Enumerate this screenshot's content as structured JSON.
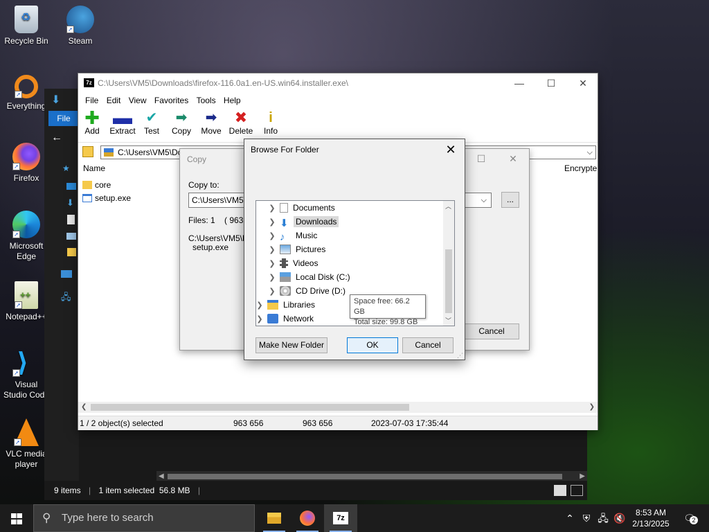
{
  "desktop": {
    "icons": [
      {
        "label": "Recycle Bin"
      },
      {
        "label": "Steam"
      },
      {
        "label": "Everything"
      },
      {
        "label": "Firefox"
      },
      {
        "label": "Microsoft Edge"
      },
      {
        "label": "Notepad++"
      },
      {
        "label": "Visual Studio Code"
      },
      {
        "label": "VLC media player"
      }
    ]
  },
  "explorer": {
    "file_tab": "File",
    "status_items": "9 items",
    "status_selected": "1 item selected  56.8 MB"
  },
  "sevenzip": {
    "title": "C:\\Users\\VM5\\Downloads\\firefox-116.0a1.en-US.win64.installer.exe\\",
    "menu": [
      "File",
      "Edit",
      "View",
      "Favorites",
      "Tools",
      "Help"
    ],
    "toolbar": [
      {
        "label": "Add",
        "icon": "add-icon"
      },
      {
        "label": "Extract",
        "icon": "extract-icon"
      },
      {
        "label": "Test",
        "icon": "test-icon"
      },
      {
        "label": "Copy",
        "icon": "copy-icon"
      },
      {
        "label": "Move",
        "icon": "move-icon"
      },
      {
        "label": "Delete",
        "icon": "delete-icon"
      },
      {
        "label": "Info",
        "icon": "info-icon"
      }
    ],
    "address": "C:\\Users\\VM5\\Do",
    "columns": {
      "name": "Name",
      "encrypted": "Encrypte"
    },
    "files": [
      {
        "name": "core",
        "type": "folder"
      },
      {
        "name": "setup.exe",
        "type": "file"
      }
    ],
    "status": {
      "selected": "1 / 2 object(s) selected",
      "size": "963 656",
      "packed": "963 656",
      "modified": "2023-07-03 17:35:44"
    }
  },
  "copy_dialog": {
    "title": "Copy",
    "copy_to_label": "Copy to:",
    "copy_to_value": "C:\\Users\\VM5\\D",
    "files_label": "Files: 1    ( 963 65",
    "path_line1": "C:\\Users\\VM5\\D",
    "path_line2": "setup.exe",
    "browse_button": "...",
    "cancel_button": "Cancel"
  },
  "browse_dialog": {
    "title": "Browse For Folder",
    "tree": [
      {
        "label": "Documents",
        "icon": "documents-icon",
        "indent": 1,
        "selected": false
      },
      {
        "label": "Downloads",
        "icon": "downloads-icon",
        "indent": 1,
        "selected": true
      },
      {
        "label": "Music",
        "icon": "music-icon",
        "indent": 1,
        "selected": false
      },
      {
        "label": "Pictures",
        "icon": "pictures-icon",
        "indent": 1,
        "selected": false
      },
      {
        "label": "Videos",
        "icon": "videos-icon",
        "indent": 1,
        "selected": false
      },
      {
        "label": "Local Disk (C:)",
        "icon": "local-disk-icon",
        "indent": 1,
        "selected": false
      },
      {
        "label": "CD Drive (D:)",
        "icon": "cd-drive-icon",
        "indent": 1,
        "selected": false
      },
      {
        "label": "Libraries",
        "icon": "libraries-icon",
        "indent": 0,
        "selected": false
      },
      {
        "label": "Network",
        "icon": "network-icon",
        "indent": 0,
        "selected": false
      }
    ],
    "tooltip_free": "Space free: 66.2 GB",
    "tooltip_total": "Total size: 99.8 GB",
    "make_new_folder": "Make New Folder",
    "ok": "OK",
    "cancel": "Cancel"
  },
  "taskbar": {
    "search_placeholder": "Type here to search",
    "time": "8:53 AM",
    "date": "2/13/2025",
    "notification_count": "2"
  }
}
